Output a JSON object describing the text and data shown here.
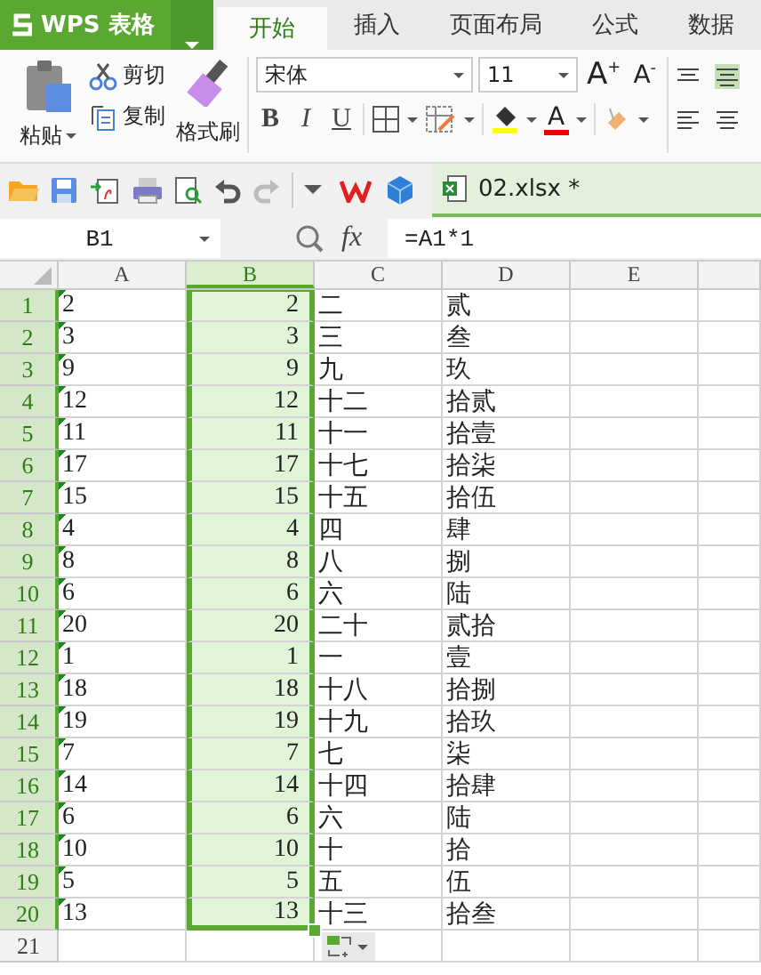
{
  "app": {
    "name": "WPS 表格"
  },
  "tabs": [
    {
      "label": "开始",
      "selected": true
    },
    {
      "label": "插入",
      "selected": false
    },
    {
      "label": "页面布局",
      "selected": false
    },
    {
      "label": "公式",
      "selected": false
    },
    {
      "label": "数据",
      "selected": false
    }
  ],
  "ribbon": {
    "paste": "粘贴",
    "actions": [
      {
        "label": "剪切",
        "kind": "cut"
      },
      {
        "label": "复制",
        "kind": "copy"
      }
    ],
    "painter": "格式刷",
    "font_name": "宋体",
    "font_size": "11",
    "grow": "A$^{+}$",
    "shrink": "A$^{-}$",
    "styles": [
      {
        "label": "B",
        "kind": "bold"
      },
      {
        "label": "I",
        "kind": "italic"
      },
      {
        "label": "U",
        "kind": "underline"
      }
    ],
    "font_color": "A"
  },
  "document_tab": {
    "title": "02.xlsx *",
    "selected": true
  },
  "formula_bar": {
    "cell": "B1",
    "fx": "fx",
    "formula": "=A1*1"
  },
  "table": {
    "columns": [
      {
        "label": "A",
        "kind": "text_number",
        "selected": false
      },
      {
        "label": "B",
        "kind": "number",
        "selected": true
      },
      {
        "label": "C",
        "kind": "text",
        "selected": false
      },
      {
        "label": "D",
        "kind": "text",
        "selected": false
      },
      {
        "label": "E",
        "kind": "text",
        "selected": false
      }
    ],
    "rows": [
      {
        "header": "1",
        "selected": true,
        "cells": [
          "2",
          "2",
          "二",
          "贰"
        ]
      },
      {
        "header": "2",
        "selected": true,
        "cells": [
          "3",
          "3",
          "三",
          "叁"
        ]
      },
      {
        "header": "3",
        "selected": true,
        "cells": [
          "9",
          "9",
          "九",
          "玖"
        ]
      },
      {
        "header": "4",
        "selected": true,
        "cells": [
          "12",
          "12",
          "十二",
          "拾贰"
        ]
      },
      {
        "header": "5",
        "selected": true,
        "cells": [
          "11",
          "11",
          "十一",
          "拾壹"
        ]
      },
      {
        "header": "6",
        "selected": true,
        "cells": [
          "17",
          "17",
          "十七",
          "拾柒"
        ]
      },
      {
        "header": "7",
        "selected": true,
        "cells": [
          "15",
          "15",
          "十五",
          "拾伍"
        ]
      },
      {
        "header": "8",
        "selected": true,
        "cells": [
          "4",
          "4",
          "四",
          "肆"
        ]
      },
      {
        "header": "9",
        "selected": true,
        "cells": [
          "8",
          "8",
          "八",
          "捌"
        ]
      },
      {
        "header": "10",
        "selected": true,
        "cells": [
          "6",
          "6",
          "六",
          "陆"
        ]
      },
      {
        "header": "11",
        "selected": true,
        "cells": [
          "20",
          "20",
          "二十",
          "贰拾"
        ]
      },
      {
        "header": "12",
        "selected": true,
        "cells": [
          "1",
          "1",
          "一",
          "壹"
        ]
      },
      {
        "header": "13",
        "selected": true,
        "cells": [
          "18",
          "18",
          "十八",
          "拾捌"
        ]
      },
      {
        "header": "14",
        "selected": true,
        "cells": [
          "19",
          "19",
          "十九",
          "拾玖"
        ]
      },
      {
        "header": "15",
        "selected": true,
        "cells": [
          "7",
          "7",
          "七",
          "柒"
        ]
      },
      {
        "header": "16",
        "selected": true,
        "cells": [
          "14",
          "14",
          "十四",
          "拾肆"
        ]
      },
      {
        "header": "17",
        "selected": true,
        "cells": [
          "6",
          "6",
          "六",
          "陆"
        ]
      },
      {
        "header": "18",
        "selected": true,
        "cells": [
          "10",
          "10",
          "十",
          "拾"
        ]
      },
      {
        "header": "19",
        "selected": true,
        "cells": [
          "5",
          "5",
          "五",
          "伍"
        ]
      },
      {
        "header": "20",
        "selected": true,
        "cells": [
          "13",
          "13",
          "十三",
          "拾叁"
        ]
      },
      {
        "header": "21",
        "selected": false,
        "cells": []
      }
    ]
  }
}
